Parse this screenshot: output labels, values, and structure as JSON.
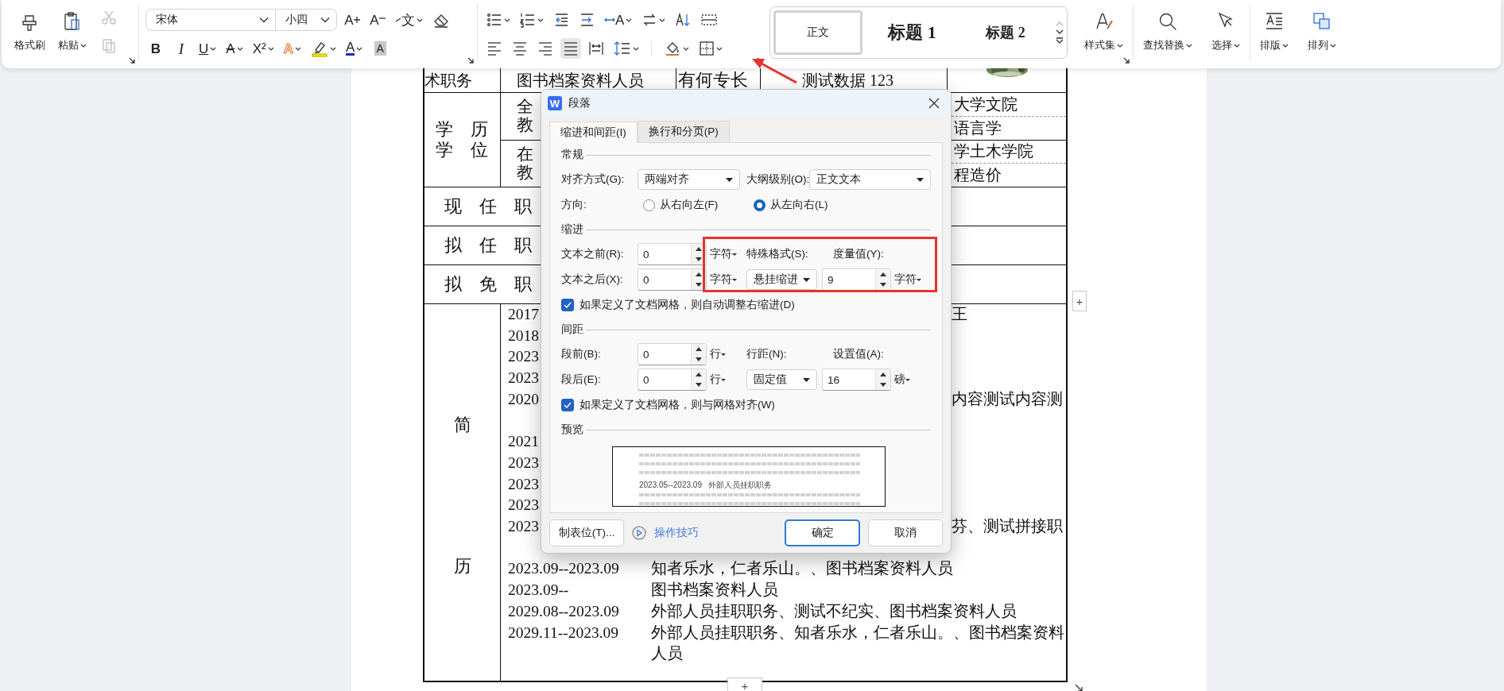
{
  "toolbar": {
    "clipboard": {
      "format_painter": "格式刷",
      "paste": "粘贴",
      "cut": {
        "disabled": true
      },
      "copy": {
        "disabled": true
      }
    },
    "font": {
      "name": "宋体",
      "size": "小四",
      "row1": [
        "A",
        "A",
        "文"
      ],
      "row2": [
        "B",
        "I",
        "U",
        "A",
        "X²",
        "A",
        "A",
        "A"
      ]
    },
    "paragraph": {
      "glyph": "A",
      "alignment": [
        {
          "selected": false
        },
        {
          "selected": false
        },
        {
          "selected": false
        },
        {
          "selected": true
        },
        {
          "selected": false
        }
      ]
    },
    "gallery": {
      "items": [
        {
          "label": "正文",
          "selected": true
        },
        {
          "label": "标题 1",
          "selected": false
        },
        {
          "label": "标题 2",
          "selected": false
        }
      ],
      "scroll_up": {
        "disabled": true
      }
    },
    "commands": [
      "样式集",
      "查找替换",
      "选择",
      "排版",
      "排列"
    ]
  },
  "dialog": {
    "badge": "W",
    "title": "段落",
    "tabs": [
      {
        "label": "缩进和间距(I)",
        "selected": true
      },
      {
        "label": "换行和分页(P)",
        "selected": false
      }
    ],
    "general": {
      "heading": "常规",
      "alignment": {
        "label": "对齐方式(G):",
        "value": "两端对齐"
      },
      "outline": {
        "label": "大纲级别(O):",
        "value": "正文文本"
      },
      "direction": {
        "label": "方向:",
        "options": [
          {
            "label": "从右向左(F)",
            "selected": false
          },
          {
            "label": "从左向右(L)",
            "selected": true
          }
        ]
      }
    },
    "indent": {
      "heading": "缩进",
      "before": {
        "label": "文本之前(R):",
        "value": "0",
        "unit": "字符"
      },
      "after": {
        "label": "文本之后(X):",
        "value": "0",
        "unit": "字符"
      },
      "special": {
        "label": "特殊格式(S):",
        "value": "悬挂缩进"
      },
      "measure": {
        "label": "度量值(Y):",
        "value": "9",
        "unit": "字符"
      },
      "grid_option": {
        "label": "如果定义了文档网格，则自动调整右缩进(D)",
        "checked": true
      }
    },
    "spacing": {
      "heading": "间距",
      "before": {
        "label": "段前(B):",
        "value": "0",
        "unit": "行"
      },
      "after": {
        "label": "段后(E):",
        "value": "0",
        "unit": "行"
      },
      "line": {
        "label": "行距(N):",
        "value": "固定值"
      },
      "setting": {
        "label": "设置值(A):",
        "value": "16",
        "unit": "磅"
      },
      "grid_option": {
        "label": "如果定义了文档网格，则与网格对齐(W)",
        "checked": true
      }
    },
    "preview": {
      "heading": "预览",
      "sample": "2023.05--2023.09   外部人员挂职职务"
    },
    "buttons": {
      "tabs": "制表位(T)...",
      "tips": "操作技巧",
      "ok": "确定",
      "cancel": "取消"
    }
  },
  "document": {
    "row1": [
      "术职务",
      "图书档案资料人员",
      "有何专长",
      "测试数据 123"
    ],
    "education": {
      "label": [
        "学　历",
        "学　位"
      ],
      "rows": [
        {
          "left": [
            "全",
            "教"
          ],
          "right": [
            "大学文院",
            "语言学"
          ]
        },
        {
          "left": [
            "在",
            "教"
          ],
          "right": [
            "学土木学院",
            "程造价"
          ]
        }
      ]
    },
    "positions": [
      "现　任　职",
      "拟　任　职",
      "拟　免　职"
    ],
    "resume": {
      "label": [
        "简",
        "历"
      ],
      "lines": [
        {
          "kind": "clipped",
          "date": "2017",
          "text": "王"
        },
        {
          "kind": "clipped",
          "date": "2018"
        },
        {
          "kind": "clipped",
          "date": "2023"
        },
        {
          "kind": "clipped",
          "date": "2023"
        },
        {
          "kind": "clipped",
          "date": "2020",
          "text": "内容测试内容测"
        },
        {
          "kind": "blank"
        },
        {
          "kind": "clipped",
          "date": "2021"
        },
        {
          "kind": "clipped",
          "date": "2023"
        },
        {
          "kind": "clipped",
          "date": "2023"
        },
        {
          "kind": "clipped",
          "date": "2023"
        },
        {
          "kind": "clipped",
          "date": "2023",
          "text": "芬、测试拼接职"
        },
        {
          "kind": "blank"
        },
        {
          "kind": "entry",
          "date": "2023.09--2023.09",
          "text": "知者乐水，仁者乐山。、图书档案资料人员"
        },
        {
          "kind": "entry",
          "date": "2023.09--",
          "text": "图书档案资料人员"
        },
        {
          "kind": "entry",
          "date": "2029.08--2023.09",
          "text": "外部人员挂职职务、测试不纪实、图书档案资料人员"
        },
        {
          "kind": "entry",
          "date": "2029.11--2023.09",
          "text": "外部人员挂职职务、知者乐水，仁者乐山。、图书档案资料人员"
        }
      ]
    }
  },
  "page_controls": {
    "add_column": "+",
    "add_row": "+"
  }
}
